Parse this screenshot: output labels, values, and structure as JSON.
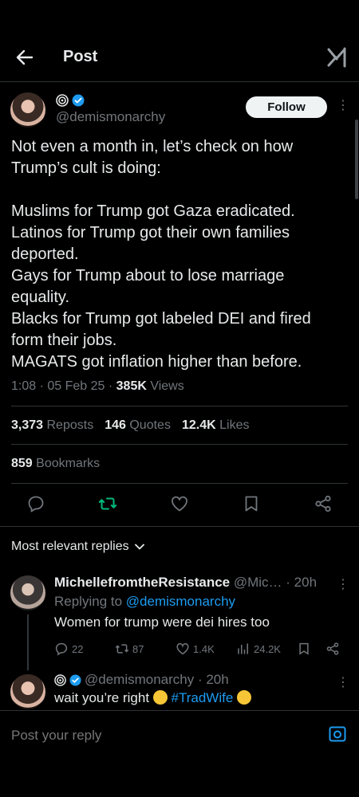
{
  "header": {
    "title": "Post",
    "back_icon": "back-arrow-icon",
    "logo_icon": "x-grok-logo-icon"
  },
  "post": {
    "handle": "@demismonarchy",
    "follow_label": "Follow",
    "more": "⋮",
    "text": "Not even a month in, let’s check on how Trump’s cult is doing:\n\nMuslims for Trump got Gaza eradicated.\nLatinos for Trump got their own families deported.\nGays for Trump about to lose marriage equality.\nBlacks for Trump got labeled DEI and fired form their jobs.\nMAGATS got inflation higher than before.",
    "time": "1:08 · 05 Feb 25 · ",
    "views_count": "385K",
    "views_label": " Views"
  },
  "stats": {
    "reposts_count": "3,373",
    "reposts_label": "Reposts",
    "quotes_count": "146",
    "quotes_label": "Quotes",
    "likes_count": "12.4K",
    "likes_label": "Likes",
    "bookmarks_count": "859",
    "bookmarks_label": "Bookmarks"
  },
  "actions": [
    "reply-icon",
    "repost-icon",
    "like-icon",
    "bookmark-icon",
    "share-icon"
  ],
  "replies_filter": "Most relevant replies",
  "replies": [
    {
      "name": "MichellefromtheResistance",
      "handle_time": " @Mic… · 20h",
      "replying_prefix": "Replying to ",
      "replying_to": "@demismonarchy",
      "text": "Women for trump were dei hires too",
      "replies": "22",
      "reposts": "87",
      "likes": "1.4K",
      "views": "24.2K"
    },
    {
      "handle_time": "@demismonarchy · 20h",
      "text_before": "wait you’re right ",
      "hashtag": "#TradWife"
    }
  ],
  "composer": {
    "placeholder": "Post your reply"
  },
  "colors": {
    "accent": "#1d9bf0",
    "repost_green": "#00ba7c",
    "muted": "#71767b",
    "background": "#000000"
  }
}
